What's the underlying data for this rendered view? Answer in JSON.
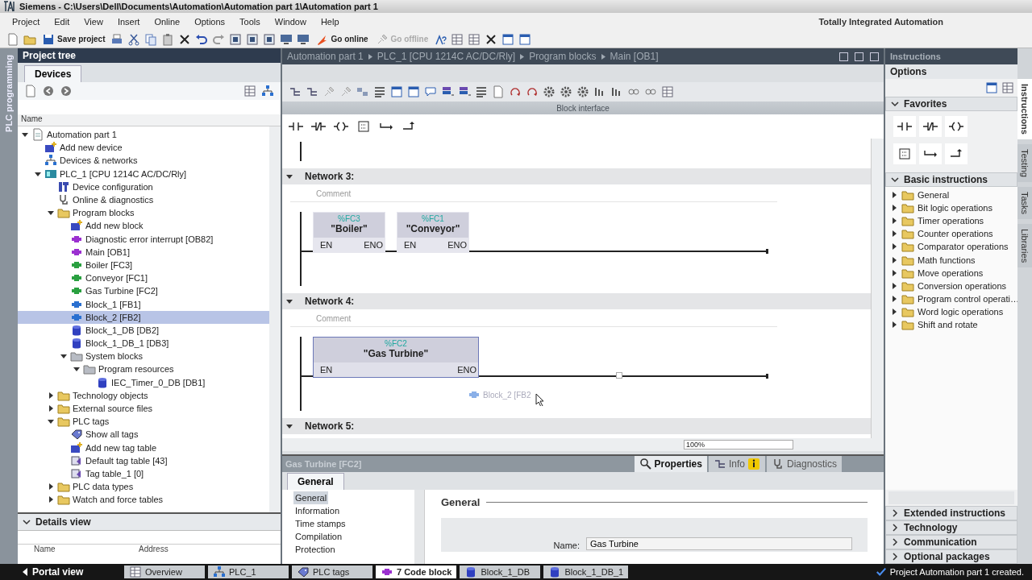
{
  "window": {
    "title": "Siemens - C:\\Users\\Dell\\Documents\\Automation\\Automation part 1\\Automation part 1",
    "product": "Totally Integrated Automation"
  },
  "menu": [
    "Project",
    "Edit",
    "View",
    "Insert",
    "Online",
    "Options",
    "Tools",
    "Window",
    "Help"
  ],
  "toolbar_buttons": [
    {
      "kind": "save",
      "label": "Save project",
      "disabled": false
    },
    {
      "kind": "online",
      "label": "Go online",
      "disabled": false
    },
    {
      "kind": "offline",
      "label": "Go offline",
      "disabled": true
    }
  ],
  "side_strip": {
    "label": "PLC programming"
  },
  "project_tree": {
    "title": "Project tree",
    "tabs": [
      {
        "label": "Devices",
        "selected": true
      }
    ],
    "column": "Name",
    "items": [
      {
        "label": "Automation part 1",
        "kind": "project",
        "selected": false,
        "expanded": true,
        "children": [
          {
            "label": "Add new device",
            "kind": "add",
            "selected": false
          },
          {
            "label": "Devices & networks",
            "kind": "network",
            "selected": false
          },
          {
            "label": "PLC_1 [CPU 1214C AC/DC/Rly]",
            "kind": "plc",
            "selected": false,
            "expanded": true,
            "children": [
              {
                "label": "Device configuration",
                "kind": "device",
                "selected": false
              },
              {
                "label": "Online & diagnostics",
                "kind": "diag",
                "selected": false
              },
              {
                "label": "Program blocks",
                "kind": "folder",
                "selected": false,
                "expanded": true,
                "children": [
                  {
                    "label": "Add new block",
                    "kind": "add",
                    "selected": false
                  },
                  {
                    "label": "Diagnostic error interrupt [OB82]",
                    "kind": "ob",
                    "selected": false
                  },
                  {
                    "label": "Main [OB1]",
                    "kind": "ob",
                    "selected": false
                  },
                  {
                    "label": "Boiler [FC3]",
                    "kind": "fc",
                    "selected": false
                  },
                  {
                    "label": "Conveyor [FC1]",
                    "kind": "fc",
                    "selected": false
                  },
                  {
                    "label": "Gas Turbine [FC2]",
                    "kind": "fc",
                    "selected": false
                  },
                  {
                    "label": "Block_1 [FB1]",
                    "kind": "fb",
                    "selected": false
                  },
                  {
                    "label": "Block_2 [FB2]",
                    "kind": "fb",
                    "selected": true
                  },
                  {
                    "label": "Block_1_DB [DB2]",
                    "kind": "db",
                    "selected": false
                  },
                  {
                    "label": "Block_1_DB_1 [DB3]",
                    "kind": "db",
                    "selected": false
                  },
                  {
                    "label": "System blocks",
                    "kind": "sysfolder",
                    "selected": false,
                    "expanded": true,
                    "children": [
                      {
                        "label": "Program resources",
                        "kind": "sysfolder",
                        "selected": false,
                        "expanded": true,
                        "children": [
                          {
                            "label": "IEC_Timer_0_DB [DB1]",
                            "kind": "db",
                            "selected": false
                          }
                        ]
                      }
                    ]
                  }
                ]
              },
              {
                "label": "Technology objects",
                "kind": "folder",
                "selected": false,
                "expanded": false
              },
              {
                "label": "External source files",
                "kind": "folder",
                "selected": false,
                "expanded": false
              },
              {
                "label": "PLC tags",
                "kind": "folder",
                "selected": false,
                "expanded": true,
                "children": [
                  {
                    "label": "Show all tags",
                    "kind": "tags",
                    "selected": false
                  },
                  {
                    "label": "Add new tag table",
                    "kind": "add",
                    "selected": false
                  },
                  {
                    "label": "Default tag table [43]",
                    "kind": "tagtable",
                    "selected": false
                  },
                  {
                    "label": "Tag table_1 [0]",
                    "kind": "tagtable",
                    "selected": false
                  }
                ]
              },
              {
                "label": "PLC data types",
                "kind": "folder",
                "selected": false,
                "expanded": false
              },
              {
                "label": "Watch and force tables",
                "kind": "folder",
                "selected": false,
                "expanded": false
              }
            ]
          }
        ]
      }
    ]
  },
  "details_view": {
    "title": "Details view",
    "expanded": true,
    "columns": [
      "Name",
      "Address"
    ]
  },
  "editor": {
    "breadcrumb": [
      "Automation part 1",
      "PLC_1 [CPU 1214C AC/DC/Rly]",
      "Program blocks",
      "Main [OB1]"
    ],
    "interface_label": "Block interface",
    "networks": [
      {
        "title": "Network 3:",
        "expanded": true,
        "comment": "Comment",
        "blocks": [
          {
            "address": "%FC3",
            "name": "\"Boiler\"",
            "en": "EN",
            "eno": "ENO",
            "selected": false
          },
          {
            "address": "%FC1",
            "name": "\"Conveyor\"",
            "en": "EN",
            "eno": "ENO",
            "selected": false
          }
        ]
      },
      {
        "title": "Network 4:",
        "expanded": true,
        "comment": "Comment",
        "blocks": [
          {
            "address": "%FC2",
            "name": "\"Gas Turbine\"",
            "en": "EN",
            "eno": "ENO",
            "selected": true
          }
        ],
        "drag_preview": "Block_2 [FB2"
      },
      {
        "title": "Network 5:",
        "expanded": true
      }
    ],
    "zoom": "100%"
  },
  "inspector": {
    "title": "Gas Turbine [FC2]",
    "tabs": [
      {
        "kind": "properties",
        "label": "Properties",
        "selected": true
      },
      {
        "kind": "info",
        "label": "Info",
        "selected": false
      },
      {
        "kind": "diagnostics",
        "label": "Diagnostics",
        "selected": false
      }
    ],
    "section_tabs": [
      {
        "label": "General",
        "selected": true
      }
    ],
    "nav": [
      {
        "label": "General",
        "selected": true
      },
      {
        "label": "Information",
        "selected": false
      },
      {
        "label": "Time stamps",
        "selected": false
      },
      {
        "label": "Compilation",
        "selected": false
      },
      {
        "label": "Protection",
        "selected": false
      }
    ],
    "heading": "General",
    "fields": [
      {
        "label": "Name:",
        "value": "Gas Turbine"
      }
    ]
  },
  "task_card": {
    "title": "Instructions",
    "options": "Options",
    "sections": [
      {
        "kind": "favorites",
        "title": "Favorites",
        "expanded": true
      },
      {
        "kind": "list",
        "title": "Basic instructions",
        "expanded": true,
        "items": [
          "General",
          "Bit logic operations",
          "Timer operations",
          "Counter operations",
          "Comparator operations",
          "Math functions",
          "Move operations",
          "Conversion operations",
          "Program control operati…",
          "Word logic operations",
          "Shift and rotate"
        ]
      },
      {
        "title": "Extended instructions",
        "expanded": false
      },
      {
        "title": "Technology",
        "expanded": false
      },
      {
        "title": "Communication",
        "expanded": false
      },
      {
        "title": "Optional packages",
        "expanded": false
      }
    ],
    "side_tabs": [
      {
        "label": "Instructions",
        "selected": true
      },
      {
        "label": "Testing",
        "selected": false
      },
      {
        "label": "Tasks",
        "selected": false
      },
      {
        "label": "Libraries",
        "selected": false
      }
    ]
  },
  "taskbar": {
    "portal_view": "Portal view",
    "tabs": [
      {
        "kind": "overview",
        "label": "Overview",
        "selected": false
      },
      {
        "kind": "plc",
        "label": "PLC_1",
        "selected": false
      },
      {
        "kind": "tags",
        "label": "PLC tags",
        "selected": false
      },
      {
        "kind": "code",
        "label": "7 Code block",
        "selected": true
      },
      {
        "kind": "db",
        "label": "Block_1_DB",
        "selected": false
      },
      {
        "kind": "db",
        "label": "Block_1_DB_1",
        "selected": false
      }
    ],
    "status": "Project Automation part 1 created."
  }
}
